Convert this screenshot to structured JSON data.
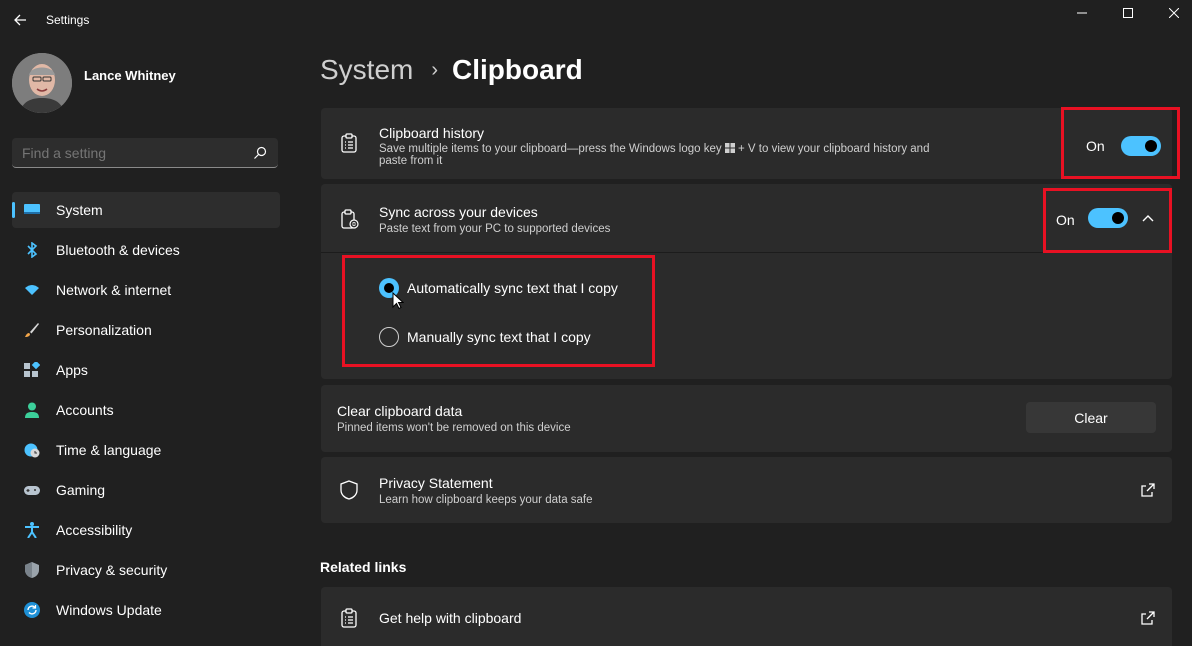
{
  "app": {
    "title": "Settings"
  },
  "user": {
    "name": "Lance Whitney"
  },
  "search": {
    "placeholder": "Find a setting"
  },
  "sidebar": {
    "items": [
      {
        "label": "System",
        "icon": "system-icon",
        "active": true
      },
      {
        "label": "Bluetooth & devices",
        "icon": "bluetooth-icon"
      },
      {
        "label": "Network & internet",
        "icon": "wifi-icon"
      },
      {
        "label": "Personalization",
        "icon": "brush-icon"
      },
      {
        "label": "Apps",
        "icon": "apps-icon"
      },
      {
        "label": "Accounts",
        "icon": "person-icon"
      },
      {
        "label": "Time & language",
        "icon": "globe-clock-icon"
      },
      {
        "label": "Gaming",
        "icon": "gamepad-icon"
      },
      {
        "label": "Accessibility",
        "icon": "accessibility-icon"
      },
      {
        "label": "Privacy & security",
        "icon": "shield-icon"
      },
      {
        "label": "Windows Update",
        "icon": "update-icon"
      }
    ]
  },
  "breadcrumb": {
    "parent": "System",
    "separator": "›",
    "current": "Clipboard"
  },
  "clipboard_history": {
    "title": "Clipboard history",
    "description_line1": "Save multiple items to your clipboard—press the Windows logo key",
    "description_key": "+ V to view your clipboard history and",
    "description_line2": "paste from it",
    "state": "On"
  },
  "sync": {
    "title": "Sync across your devices",
    "description": "Paste text from your PC to supported devices",
    "state": "On",
    "options": [
      {
        "label": "Automatically sync text that I copy",
        "selected": true
      },
      {
        "label": "Manually sync text that I copy",
        "selected": false
      }
    ]
  },
  "clear_data": {
    "title": "Clear clipboard data",
    "description": "Pinned items won't be removed on this device",
    "button": "Clear"
  },
  "privacy": {
    "title": "Privacy Statement",
    "description": "Learn how clipboard keeps your data safe"
  },
  "related": {
    "heading": "Related links",
    "help_link": "Get help with clipboard"
  },
  "colors": {
    "accent": "#4cc2ff",
    "highlight": "#e81123",
    "background": "#202020",
    "card": "#2b2b2b"
  }
}
